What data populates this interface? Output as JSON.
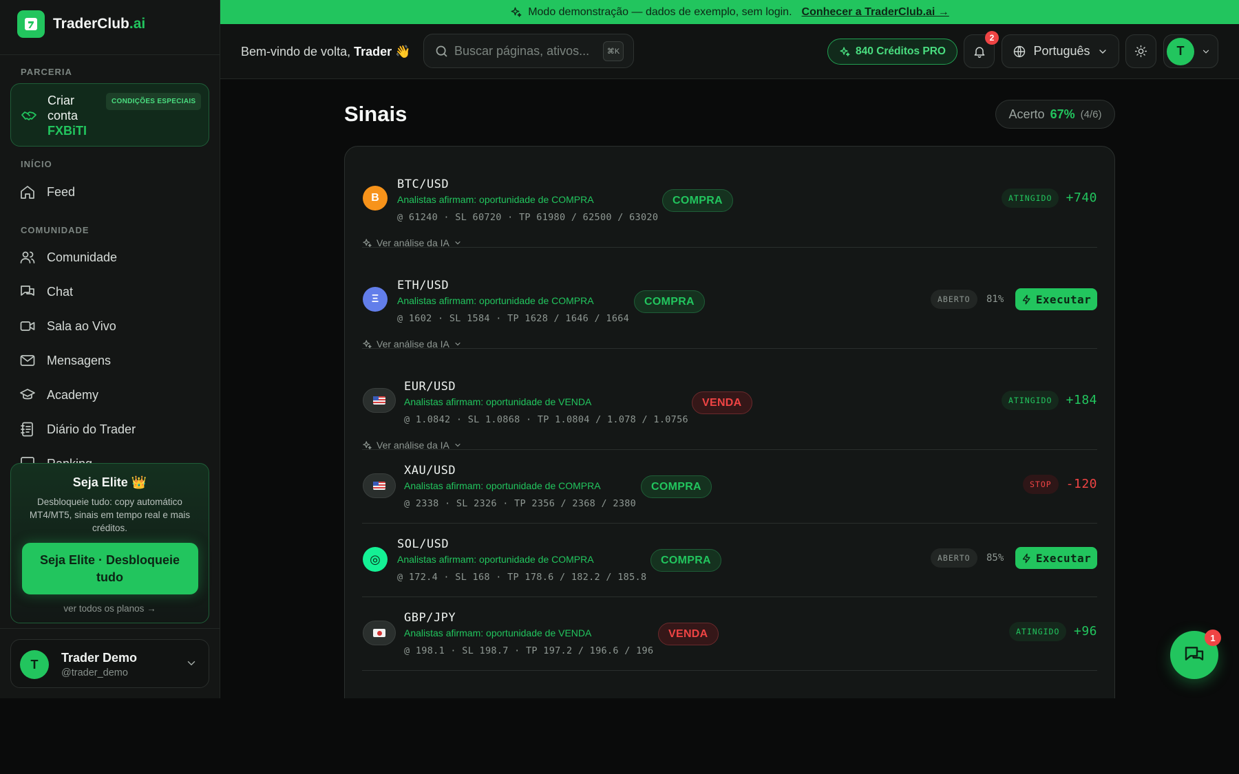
{
  "brand": {
    "name": "TraderClub",
    "suffix": ".ai"
  },
  "colors": {
    "accent": "#22c55e",
    "sell": "#ef4444",
    "background": "#0a0b0b",
    "panel": "#141716"
  },
  "banner": {
    "text": "Modo demonstração — dados de exemplo, sem login.",
    "link": "Conhecer a TraderClub.ai →"
  },
  "header": {
    "welcome_prefix": "Bem-vindo de volta, ",
    "welcome_name": "Trader",
    "welcome_emoji": "👋",
    "search_placeholder": "Buscar páginas, ativos...",
    "search_shortcut": "⌘K",
    "credits": "840 Créditos PRO",
    "notifications_count": "2",
    "language": "Português",
    "avatar_initial": "T"
  },
  "sidebar": {
    "partner_section": "PARCERIA",
    "partner": {
      "line1": "Criar",
      "line2": "conta",
      "highlight": "FXBiTI",
      "badge": "CONDIÇÕES ESPECIAIS"
    },
    "sections": [
      {
        "title": "INÍCIO",
        "items": [
          {
            "label": "Feed",
            "icon": "home-icon"
          }
        ]
      },
      {
        "title": "COMUNIDADE",
        "items": [
          {
            "label": "Comunidade",
            "icon": "users-icon"
          },
          {
            "label": "Chat",
            "icon": "chat-icon"
          },
          {
            "label": "Sala ao Vivo",
            "icon": "video-icon"
          },
          {
            "label": "Mensagens",
            "icon": "mail-icon"
          },
          {
            "label": "Academy",
            "icon": "graduation-cap-icon"
          },
          {
            "label": "Diário do Trader",
            "icon": "notebook-icon"
          },
          {
            "label": "Ranking",
            "icon": "trophy-icon"
          }
        ]
      }
    ],
    "elite": {
      "title": "Seja Elite 👑",
      "description": "Desbloqueie tudo: copy automático MT4/MT5, sinais em tempo real e mais créditos.",
      "button": "Seja Elite · Desbloqueie tudo",
      "link": "ver todos os planos →"
    },
    "user": {
      "initial": "T",
      "name": "Trader Demo",
      "handle": "@trader_demo"
    }
  },
  "main": {
    "title": "Sinais",
    "accuracy": {
      "label": "Acerto",
      "value": "67%",
      "fraction": "(4/6)"
    },
    "ai_link": "Ver análise da IA",
    "execute_label": "Executar",
    "signals": [
      {
        "pair": "BTC/USD",
        "icon": "bitcoin-icon",
        "icon_text": "B",
        "icon_color": "#f7931a",
        "description": "Analistas afirmam: oportunidade de COMPRA",
        "levels": "@ 61240 · SL 60720 · TP 61980 / 62500 / 63020",
        "side": "COMPRA",
        "status": "ATINGIDO",
        "result": "+740"
      },
      {
        "pair": "ETH/USD",
        "icon": "ethereum-icon",
        "icon_text": "Ξ",
        "icon_color": "#627eea",
        "description": "Analistas afirmam: oportunidade de COMPRA",
        "levels": "@ 1602 · SL 1584 · TP 1628 / 1646 / 1664",
        "side": "COMPRA",
        "status": "ABERTO",
        "confidence": "81%"
      },
      {
        "pair": "EUR/USD",
        "icon": "us-flag-icon",
        "description": "Analistas afirmam: oportunidade de VENDA",
        "levels": "@ 1.0842 · SL 1.0868 · TP 1.0804 / 1.078 / 1.0756",
        "side": "VENDA",
        "status": "ATINGIDO",
        "result": "+184"
      },
      {
        "pair": "XAU/USD",
        "icon": "us-flag-icon",
        "description": "Analistas afirmam: oportunidade de COMPRA",
        "levels": "@ 2338 · SL 2326 · TP 2356 / 2368 / 2380",
        "side": "COMPRA",
        "status": "STOP",
        "result": "-120"
      },
      {
        "pair": "SOL/USD",
        "icon": "solana-icon",
        "icon_text": "◎",
        "icon_color": "#14f195",
        "description": "Analistas afirmam: oportunidade de COMPRA",
        "levels": "@ 172.4 · SL 168 · TP 178.6 / 182.2 / 185.8",
        "side": "COMPRA",
        "status": "ABERTO",
        "confidence": "85%"
      },
      {
        "pair": "GBP/JPY",
        "icon": "japan-flag-icon",
        "description": "Analistas afirmam: oportunidade de VENDA",
        "levels": "@ 198.1 · SL 198.7 · TP 197.2 / 196.6 / 196",
        "side": "VENDA",
        "status": "ATINGIDO",
        "result": "+96"
      }
    ]
  },
  "chat_fab": {
    "badge": "1"
  }
}
